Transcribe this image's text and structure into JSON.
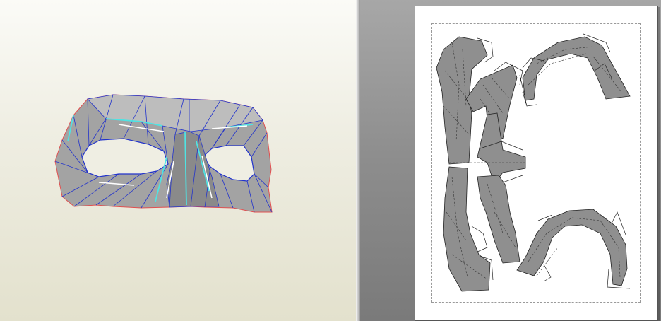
{
  "app": {
    "panes": [
      "3D view",
      "2D view"
    ]
  },
  "model3d": {
    "object": "mask",
    "face_color": "#9b9b9b",
    "outline_color": "#e05050",
    "fold_color": "#2233cc",
    "highlight_color": "#4fe3e3"
  },
  "unfold2d": {
    "part_color": "#8f8f8f",
    "outline_color": "#222222",
    "dash_color": "#333333",
    "print_area_border": "#9a9a9a"
  }
}
